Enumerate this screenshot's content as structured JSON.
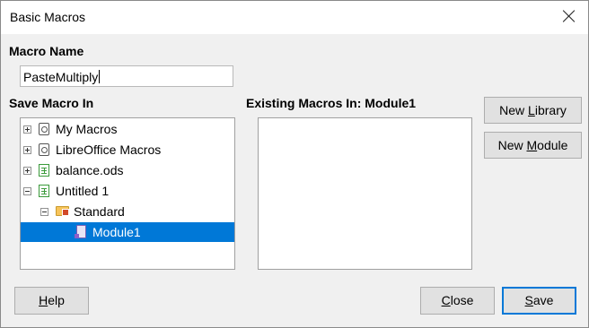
{
  "window": {
    "title": "Basic Macros"
  },
  "macro_name": {
    "label": "Macro Name",
    "value": "PasteMultiply"
  },
  "save_macro_in": {
    "label": "Save Macro In",
    "tree": [
      {
        "label": "My Macros",
        "icon": "macro-library-icon",
        "expander": "plus"
      },
      {
        "label": "LibreOffice Macros",
        "icon": "macro-library-icon",
        "expander": "plus"
      },
      {
        "label": "balance.ods",
        "icon": "spreadsheet-icon",
        "expander": "plus"
      },
      {
        "label": "Untitled 1",
        "icon": "spreadsheet-icon",
        "expander": "minus"
      },
      {
        "label": "Standard",
        "icon": "folder-icon",
        "expander": "minus"
      },
      {
        "label": "Module1",
        "icon": "module-icon",
        "selected": true
      }
    ]
  },
  "existing_macros": {
    "label": "Existing Macros In: Module1"
  },
  "buttons": {
    "new_library": {
      "pre": "New ",
      "mnemonic": "L",
      "post": "ibrary"
    },
    "new_module": {
      "pre": "New ",
      "mnemonic": "M",
      "post": "odule"
    },
    "help": {
      "pre": "",
      "mnemonic": "H",
      "post": "elp"
    },
    "close": {
      "pre": "",
      "mnemonic": "C",
      "post": "lose"
    },
    "save": {
      "pre": "",
      "mnemonic": "S",
      "post": "ave"
    }
  },
  "colors": {
    "selection": "#0078d7",
    "default_button_border": "#0078d7"
  }
}
